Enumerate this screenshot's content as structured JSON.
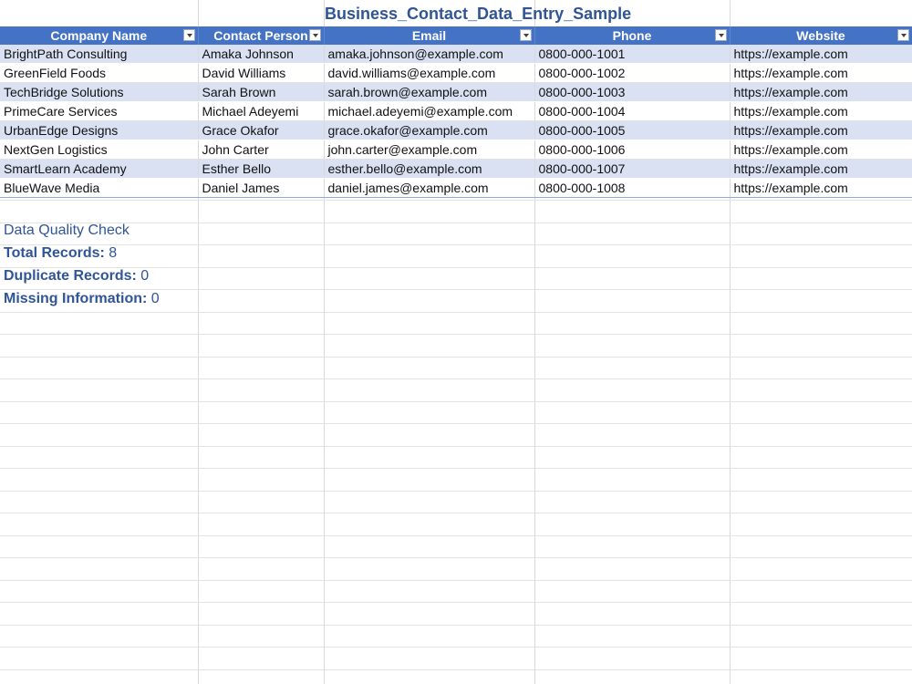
{
  "sheet": {
    "title": "Business_Contact_Data_Entry_Sample"
  },
  "table": {
    "headers": [
      "Company Name",
      "Contact Person",
      "Email",
      "Phone",
      "Website"
    ],
    "rows": [
      [
        "BrightPath Consulting",
        "Amaka Johnson",
        "amaka.johnson@example.com",
        "0800-000-1001",
        "https://example.com"
      ],
      [
        "GreenField Foods",
        "David Williams",
        "david.williams@example.com",
        "0800-000-1002",
        "https://example.com"
      ],
      [
        "TechBridge Solutions",
        "Sarah Brown",
        "sarah.brown@example.com",
        "0800-000-1003",
        "https://example.com"
      ],
      [
        "PrimeCare Services",
        "Michael Adeyemi",
        "michael.adeyemi@example.com",
        "0800-000-1004",
        "https://example.com"
      ],
      [
        "UrbanEdge Designs",
        "Grace Okafor",
        "grace.okafor@example.com",
        "0800-000-1005",
        "https://example.com"
      ],
      [
        "NextGen Logistics",
        "John Carter",
        "john.carter@example.com",
        "0800-000-1006",
        "https://example.com"
      ],
      [
        "SmartLearn Academy",
        "Esther Bello",
        "esther.bello@example.com",
        "0800-000-1007",
        "https://example.com"
      ],
      [
        "BlueWave Media",
        "Daniel James",
        "daniel.james@example.com",
        "0800-000-1008",
        "https://example.com"
      ]
    ]
  },
  "quality": {
    "heading": "Data Quality Check",
    "total_label": "Total Records:",
    "total_value": "8",
    "duplicate_label": "Duplicate Records:",
    "duplicate_value": "0",
    "missing_label": "Missing Information:",
    "missing_value": "0"
  },
  "colors": {
    "header_fill": "#4472c4",
    "band_fill": "#d9e1f2",
    "accent_text": "#2f5597"
  }
}
